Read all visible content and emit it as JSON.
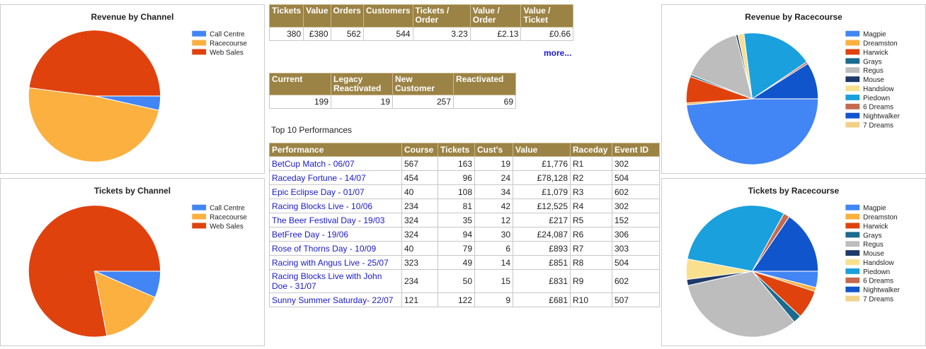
{
  "summary_table": {
    "headers": [
      "Tickets",
      "Value",
      "Orders",
      "Customers",
      "Tickets / Order",
      "Value / Order",
      "Value / Ticket"
    ],
    "values": [
      "380",
      "£380",
      "562",
      "544",
      "3.23",
      "£2.13",
      "£0.66"
    ]
  },
  "more_link": "more...",
  "status_table": {
    "headers": [
      "Current",
      "Legacy Reactivated",
      "New Customer",
      "Reactivated"
    ],
    "values": [
      "199",
      "19",
      "257",
      "69"
    ]
  },
  "top10_title": "Top 10 Performances",
  "performance_table": {
    "headers": [
      "Performance",
      "Course",
      "Tickets",
      "Cust's",
      "Value",
      "Raceday",
      "Event ID"
    ],
    "rows": [
      [
        "BetCup Match - 06/07",
        "567",
        "163",
        "19",
        "£1,776",
        "R1",
        "302"
      ],
      [
        "Raceday Fortune - 14/07",
        "454",
        "96",
        "24",
        "£78,128",
        "R2",
        "504"
      ],
      [
        "Epic Eclipse Day - 01/07",
        "40",
        "108",
        "34",
        "£1,079",
        "R3",
        "602"
      ],
      [
        "Racing Blocks Live - 10/06",
        "234",
        "81",
        "42",
        "£12,525",
        "R4",
        "302"
      ],
      [
        "The Beer Festival Day - 19/03",
        "324",
        "35",
        "12",
        "£217",
        "R5",
        "152"
      ],
      [
        "BetFree Day - 19/06",
        "324",
        "94",
        "30",
        "£24,087",
        "R6",
        "306"
      ],
      [
        "Rose of Thorns Day - 10/09",
        "40",
        "79",
        "6",
        "£893",
        "R7",
        "303"
      ],
      [
        "Racing with Angus Live - 25/07",
        "323",
        "49",
        "14",
        "£851",
        "R8",
        "504"
      ],
      [
        "Racing Blocks Live with John Doe - 31/07",
        "234",
        "50",
        "15",
        "£831",
        "R9",
        "602"
      ],
      [
        "Sunny Summer Saturday- 22/07",
        "121",
        "122",
        "9",
        "£681",
        "R10",
        "507"
      ]
    ]
  },
  "chart_data": [
    {
      "id": "rev-channel",
      "type": "pie",
      "title": "Revenue by Channel",
      "legend_position": "right",
      "labels": [
        "Call Centre",
        "Racecourse",
        "Web Sales"
      ],
      "values": [
        3.5,
        48.5,
        48
      ],
      "colors": [
        "#4285f4",
        "#fbb040",
        "#e0420e"
      ]
    },
    {
      "id": "tix-channel",
      "type": "pie",
      "title": "Tickets by Channel",
      "legend_position": "right",
      "labels": [
        "Call Centre",
        "Racecourse",
        "Web Sales"
      ],
      "values": [
        6.5,
        15.5,
        78
      ],
      "colors": [
        "#4285f4",
        "#fbb040",
        "#e0420e"
      ]
    },
    {
      "id": "rev-course",
      "type": "pie",
      "title": "Revenue by Racecourse",
      "legend_position": "right",
      "labels": [
        "Magpie",
        "Dreamston",
        "Harwick",
        "Grays",
        "Regus",
        "Mouse",
        "Handslow",
        "Piedown",
        "6 Dreams",
        "Nightwalker",
        "7 Dreams"
      ],
      "values": [
        48.5,
        0.5,
        6.5,
        0.5,
        15,
        0.5,
        1.5,
        17.5,
        0.5,
        9,
        0
      ],
      "colors": [
        "#4285f4",
        "#fbb040",
        "#e0420e",
        "#1a6b8e",
        "#bdbdbd",
        "#1e3a6b",
        "#f8e08e",
        "#1aa0dc",
        "#c56a4e",
        "#1155cc",
        "#f2d28a"
      ]
    },
    {
      "id": "tix-course",
      "type": "pie",
      "title": "Tickets by Racecourse",
      "legend_position": "right",
      "labels": [
        "Magpie",
        "Dreamston",
        "Harwick",
        "Grays",
        "Regus",
        "Mouse",
        "Handslow",
        "Piedown",
        "6 Dreams",
        "Nightwalker",
        "7 Dreams"
      ],
      "values": [
        4,
        1,
        7,
        2,
        32.5,
        1.5,
        5,
        30,
        1.5,
        15.5,
        0
      ],
      "colors": [
        "#4285f4",
        "#fbb040",
        "#e0420e",
        "#1a6b8e",
        "#bdbdbd",
        "#1e3a6b",
        "#f8e08e",
        "#1aa0dc",
        "#c56a4e",
        "#1155cc",
        "#f2d28a"
      ]
    }
  ]
}
